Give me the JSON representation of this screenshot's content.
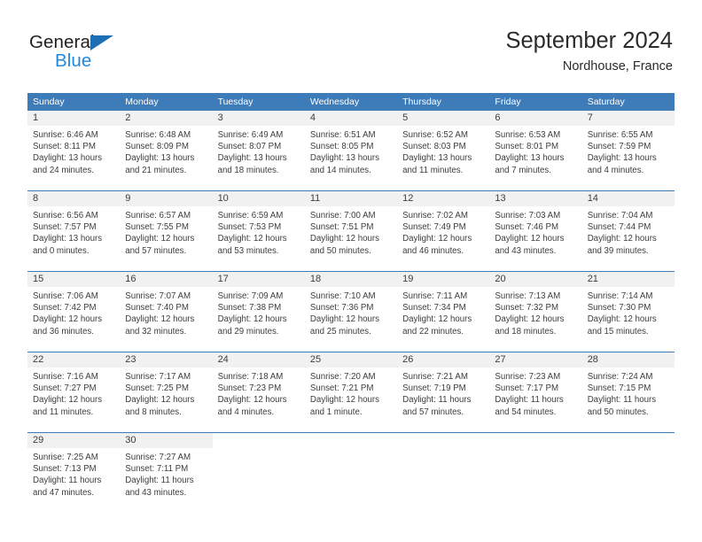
{
  "brand": {
    "name_part1": "General",
    "name_part2": "Blue",
    "accent_color": "#2288dd",
    "triangle_color": "#1c6fb5"
  },
  "header": {
    "title": "September 2024",
    "location": "Nordhouse, France"
  },
  "calendar": {
    "header_bg": "#3e7cb9",
    "weekdays": [
      "Sunday",
      "Monday",
      "Tuesday",
      "Wednesday",
      "Thursday",
      "Friday",
      "Saturday"
    ],
    "weeks": [
      [
        {
          "day": "1",
          "sunrise": "Sunrise: 6:46 AM",
          "sunset": "Sunset: 8:11 PM",
          "daylight_1": "Daylight: 13 hours",
          "daylight_2": "and 24 minutes."
        },
        {
          "day": "2",
          "sunrise": "Sunrise: 6:48 AM",
          "sunset": "Sunset: 8:09 PM",
          "daylight_1": "Daylight: 13 hours",
          "daylight_2": "and 21 minutes."
        },
        {
          "day": "3",
          "sunrise": "Sunrise: 6:49 AM",
          "sunset": "Sunset: 8:07 PM",
          "daylight_1": "Daylight: 13 hours",
          "daylight_2": "and 18 minutes."
        },
        {
          "day": "4",
          "sunrise": "Sunrise: 6:51 AM",
          "sunset": "Sunset: 8:05 PM",
          "daylight_1": "Daylight: 13 hours",
          "daylight_2": "and 14 minutes."
        },
        {
          "day": "5",
          "sunrise": "Sunrise: 6:52 AM",
          "sunset": "Sunset: 8:03 PM",
          "daylight_1": "Daylight: 13 hours",
          "daylight_2": "and 11 minutes."
        },
        {
          "day": "6",
          "sunrise": "Sunrise: 6:53 AM",
          "sunset": "Sunset: 8:01 PM",
          "daylight_1": "Daylight: 13 hours",
          "daylight_2": "and 7 minutes."
        },
        {
          "day": "7",
          "sunrise": "Sunrise: 6:55 AM",
          "sunset": "Sunset: 7:59 PM",
          "daylight_1": "Daylight: 13 hours",
          "daylight_2": "and 4 minutes."
        }
      ],
      [
        {
          "day": "8",
          "sunrise": "Sunrise: 6:56 AM",
          "sunset": "Sunset: 7:57 PM",
          "daylight_1": "Daylight: 13 hours",
          "daylight_2": "and 0 minutes."
        },
        {
          "day": "9",
          "sunrise": "Sunrise: 6:57 AM",
          "sunset": "Sunset: 7:55 PM",
          "daylight_1": "Daylight: 12 hours",
          "daylight_2": "and 57 minutes."
        },
        {
          "day": "10",
          "sunrise": "Sunrise: 6:59 AM",
          "sunset": "Sunset: 7:53 PM",
          "daylight_1": "Daylight: 12 hours",
          "daylight_2": "and 53 minutes."
        },
        {
          "day": "11",
          "sunrise": "Sunrise: 7:00 AM",
          "sunset": "Sunset: 7:51 PM",
          "daylight_1": "Daylight: 12 hours",
          "daylight_2": "and 50 minutes."
        },
        {
          "day": "12",
          "sunrise": "Sunrise: 7:02 AM",
          "sunset": "Sunset: 7:49 PM",
          "daylight_1": "Daylight: 12 hours",
          "daylight_2": "and 46 minutes."
        },
        {
          "day": "13",
          "sunrise": "Sunrise: 7:03 AM",
          "sunset": "Sunset: 7:46 PM",
          "daylight_1": "Daylight: 12 hours",
          "daylight_2": "and 43 minutes."
        },
        {
          "day": "14",
          "sunrise": "Sunrise: 7:04 AM",
          "sunset": "Sunset: 7:44 PM",
          "daylight_1": "Daylight: 12 hours",
          "daylight_2": "and 39 minutes."
        }
      ],
      [
        {
          "day": "15",
          "sunrise": "Sunrise: 7:06 AM",
          "sunset": "Sunset: 7:42 PM",
          "daylight_1": "Daylight: 12 hours",
          "daylight_2": "and 36 minutes."
        },
        {
          "day": "16",
          "sunrise": "Sunrise: 7:07 AM",
          "sunset": "Sunset: 7:40 PM",
          "daylight_1": "Daylight: 12 hours",
          "daylight_2": "and 32 minutes."
        },
        {
          "day": "17",
          "sunrise": "Sunrise: 7:09 AM",
          "sunset": "Sunset: 7:38 PM",
          "daylight_1": "Daylight: 12 hours",
          "daylight_2": "and 29 minutes."
        },
        {
          "day": "18",
          "sunrise": "Sunrise: 7:10 AM",
          "sunset": "Sunset: 7:36 PM",
          "daylight_1": "Daylight: 12 hours",
          "daylight_2": "and 25 minutes."
        },
        {
          "day": "19",
          "sunrise": "Sunrise: 7:11 AM",
          "sunset": "Sunset: 7:34 PM",
          "daylight_1": "Daylight: 12 hours",
          "daylight_2": "and 22 minutes."
        },
        {
          "day": "20",
          "sunrise": "Sunrise: 7:13 AM",
          "sunset": "Sunset: 7:32 PM",
          "daylight_1": "Daylight: 12 hours",
          "daylight_2": "and 18 minutes."
        },
        {
          "day": "21",
          "sunrise": "Sunrise: 7:14 AM",
          "sunset": "Sunset: 7:30 PM",
          "daylight_1": "Daylight: 12 hours",
          "daylight_2": "and 15 minutes."
        }
      ],
      [
        {
          "day": "22",
          "sunrise": "Sunrise: 7:16 AM",
          "sunset": "Sunset: 7:27 PM",
          "daylight_1": "Daylight: 12 hours",
          "daylight_2": "and 11 minutes."
        },
        {
          "day": "23",
          "sunrise": "Sunrise: 7:17 AM",
          "sunset": "Sunset: 7:25 PM",
          "daylight_1": "Daylight: 12 hours",
          "daylight_2": "and 8 minutes."
        },
        {
          "day": "24",
          "sunrise": "Sunrise: 7:18 AM",
          "sunset": "Sunset: 7:23 PM",
          "daylight_1": "Daylight: 12 hours",
          "daylight_2": "and 4 minutes."
        },
        {
          "day": "25",
          "sunrise": "Sunrise: 7:20 AM",
          "sunset": "Sunset: 7:21 PM",
          "daylight_1": "Daylight: 12 hours",
          "daylight_2": "and 1 minute."
        },
        {
          "day": "26",
          "sunrise": "Sunrise: 7:21 AM",
          "sunset": "Sunset: 7:19 PM",
          "daylight_1": "Daylight: 11 hours",
          "daylight_2": "and 57 minutes."
        },
        {
          "day": "27",
          "sunrise": "Sunrise: 7:23 AM",
          "sunset": "Sunset: 7:17 PM",
          "daylight_1": "Daylight: 11 hours",
          "daylight_2": "and 54 minutes."
        },
        {
          "day": "28",
          "sunrise": "Sunrise: 7:24 AM",
          "sunset": "Sunset: 7:15 PM",
          "daylight_1": "Daylight: 11 hours",
          "daylight_2": "and 50 minutes."
        }
      ],
      [
        {
          "day": "29",
          "sunrise": "Sunrise: 7:25 AM",
          "sunset": "Sunset: 7:13 PM",
          "daylight_1": "Daylight: 11 hours",
          "daylight_2": "and 47 minutes."
        },
        {
          "day": "30",
          "sunrise": "Sunrise: 7:27 AM",
          "sunset": "Sunset: 7:11 PM",
          "daylight_1": "Daylight: 11 hours",
          "daylight_2": "and 43 minutes."
        },
        {
          "day": "",
          "sunrise": "",
          "sunset": "",
          "daylight_1": "",
          "daylight_2": ""
        },
        {
          "day": "",
          "sunrise": "",
          "sunset": "",
          "daylight_1": "",
          "daylight_2": ""
        },
        {
          "day": "",
          "sunrise": "",
          "sunset": "",
          "daylight_1": "",
          "daylight_2": ""
        },
        {
          "day": "",
          "sunrise": "",
          "sunset": "",
          "daylight_1": "",
          "daylight_2": ""
        },
        {
          "day": "",
          "sunrise": "",
          "sunset": "",
          "daylight_1": "",
          "daylight_2": ""
        }
      ]
    ]
  }
}
